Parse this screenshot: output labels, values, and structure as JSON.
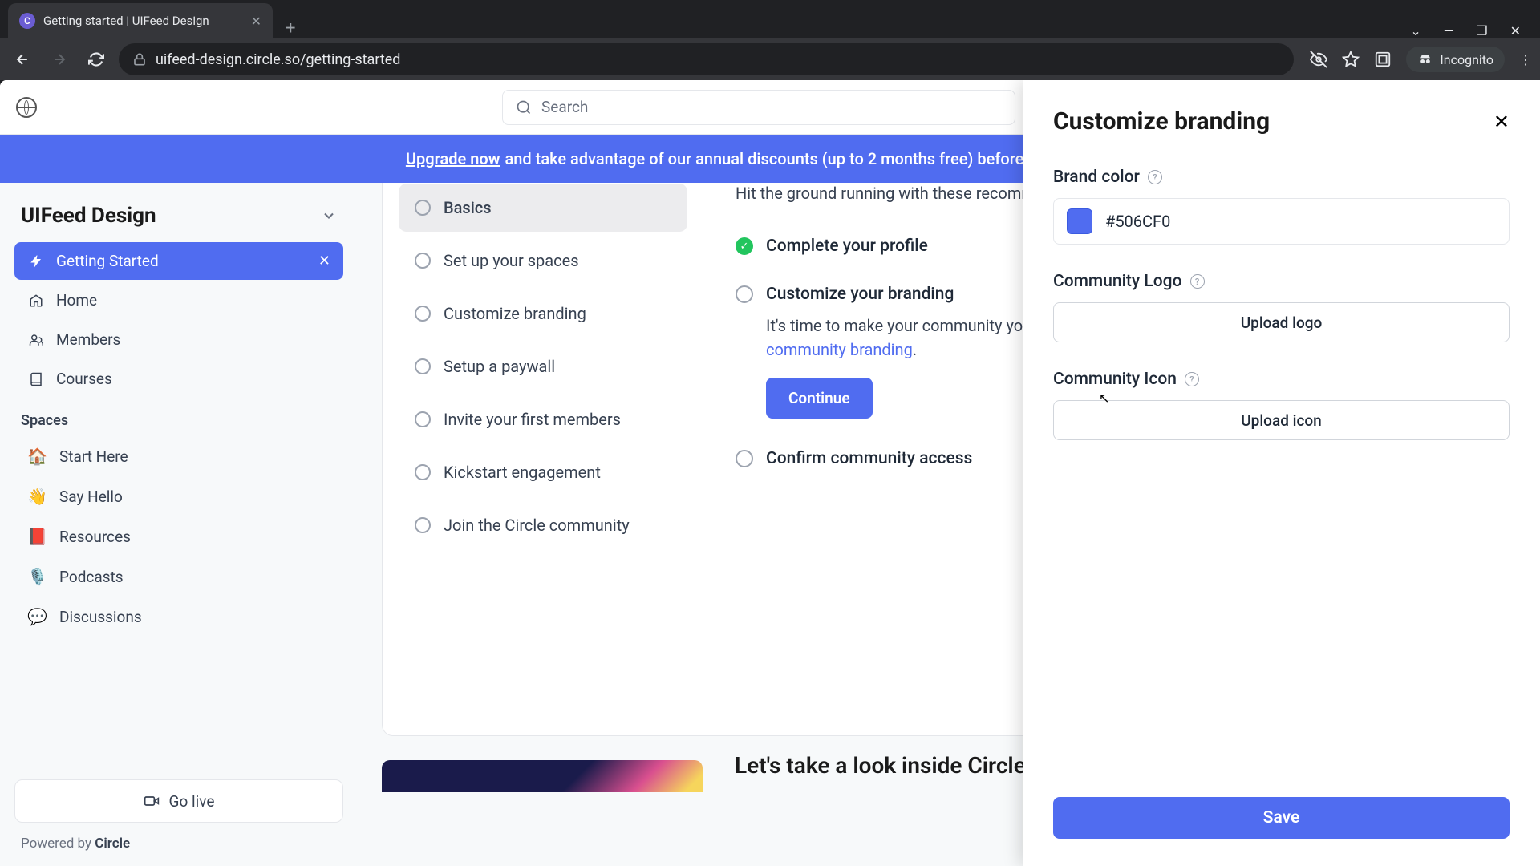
{
  "browser": {
    "tab_title": "Getting started | UIFeed Design",
    "url_display": "uifeed-design.circle.so/getting-started",
    "incognito_label": "Incognito"
  },
  "topbar": {
    "search_placeholder": "Search"
  },
  "banner": {
    "link": "Upgrade now",
    "text": " and take advantage of our annual discounts (up to 2 months free) before your trial ends."
  },
  "sidebar": {
    "community": "UIFeed Design",
    "items": [
      {
        "label": "Getting Started",
        "active": true,
        "closable": true
      },
      {
        "label": "Home"
      },
      {
        "label": "Members"
      },
      {
        "label": "Courses"
      }
    ],
    "spaces_label": "Spaces",
    "spaces": [
      {
        "emoji": "🏠",
        "label": "Start Here"
      },
      {
        "emoji": "👋",
        "label": "Say Hello"
      },
      {
        "emoji": "📕",
        "label": "Resources"
      },
      {
        "emoji": "🎙️",
        "label": "Podcasts"
      },
      {
        "emoji": "💬",
        "label": "Discussions"
      }
    ],
    "go_live": "Go live",
    "powered_prefix": "Powered by ",
    "powered_brand": "Circle"
  },
  "checklist": {
    "items": [
      "Basics",
      "Set up your spaces",
      "Customize branding",
      "Setup a paywall",
      "Invite your first members",
      "Kickstart engagement",
      "Join the Circle community"
    ]
  },
  "detail": {
    "subtitle": "Hit the ground running with these recommended steps.",
    "task_done": "Complete your profile",
    "task_open": "Customize your branding",
    "desc_1": "It's time to make your community yours! Set a brand color, upload a logo, and finalize your ",
    "desc_link": "community branding",
    "desc_2": ".",
    "continue": "Continue",
    "task_confirm": "Confirm community access",
    "next_heading": "Let's take a look inside Circle"
  },
  "panel": {
    "title": "Customize branding",
    "brand_color_label": "Brand color",
    "brand_color_value": "#506CF0",
    "logo_label": "Community Logo",
    "logo_button": "Upload logo",
    "icon_label": "Community Icon",
    "icon_button": "Upload icon",
    "save": "Save"
  }
}
